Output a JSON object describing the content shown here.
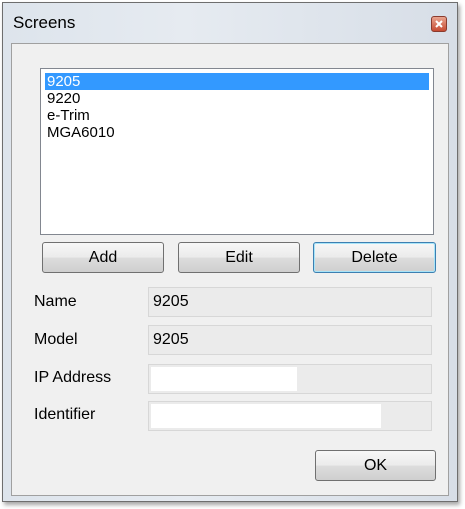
{
  "window": {
    "title": "Screens"
  },
  "screens": {
    "items": [
      "9205",
      "9220",
      "e-Trim",
      "MGA6010"
    ],
    "selected_index": 0
  },
  "buttons": {
    "add": "Add",
    "edit": "Edit",
    "delete": "Delete",
    "ok": "OK"
  },
  "fields": {
    "name": {
      "label": "Name",
      "value": "9205"
    },
    "model": {
      "label": "Model",
      "value": "9205"
    },
    "ip_address": {
      "label": "IP Address",
      "value": ""
    },
    "identifier": {
      "label": "Identifier",
      "value": ""
    }
  }
}
